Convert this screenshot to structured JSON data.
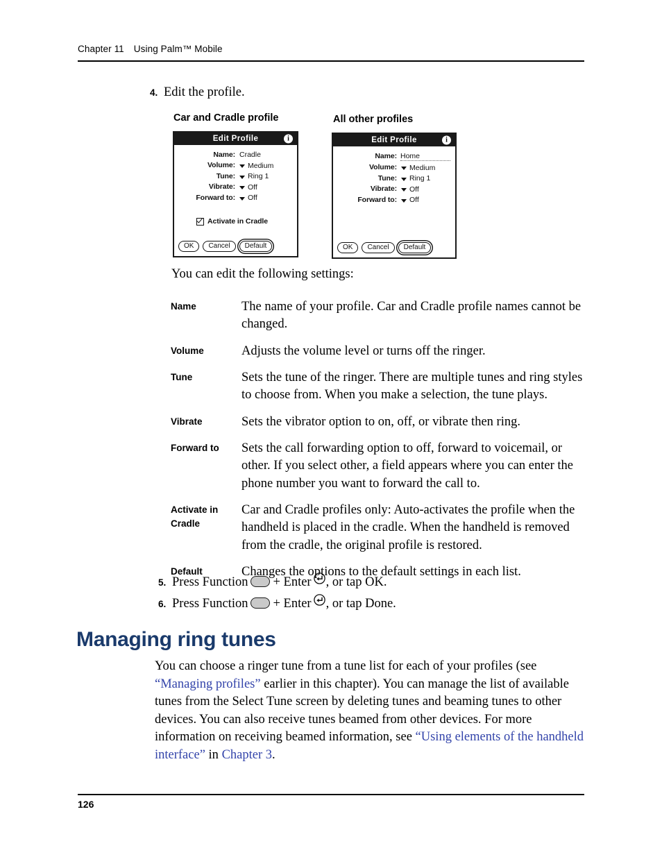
{
  "header": {
    "chapter": "Chapter 11",
    "title": "Using Palm™ Mobile"
  },
  "steps": {
    "step4": {
      "number": "4.",
      "text": "Edit the profile."
    },
    "step5": {
      "number": "5.",
      "prefix": "Press Function",
      "middle": "+ Enter",
      "suffix": ", or tap OK."
    },
    "step6": {
      "number": "6.",
      "prefix": "Press Function",
      "middle": "+ Enter",
      "suffix": ", or tap Done."
    }
  },
  "figure": {
    "left_label": "Car and Cradle profile",
    "right_label": "All other profiles",
    "left_device": {
      "title": "Edit Profile",
      "info_icon": "info-icon",
      "fields": [
        {
          "label": "Name:",
          "value": "Cradle",
          "has_dropdown": false,
          "editable": false
        },
        {
          "label": "Volume:",
          "value": "Medium",
          "has_dropdown": true,
          "editable": false
        },
        {
          "label": "Tune:",
          "value": "Ring 1",
          "has_dropdown": true,
          "editable": false
        },
        {
          "label": "Vibrate:",
          "value": "Off",
          "has_dropdown": true,
          "editable": false
        },
        {
          "label": "Forward to:",
          "value": "Off",
          "has_dropdown": true,
          "editable": false
        }
      ],
      "checkbox_label": "Activate in Cradle",
      "checkbox_checked": true,
      "buttons": [
        {
          "label": "OK",
          "emphasis": false
        },
        {
          "label": "Cancel",
          "emphasis": false
        },
        {
          "label": "Default",
          "emphasis": true
        }
      ]
    },
    "right_device": {
      "title": "Edit Profile",
      "info_icon": "info-icon",
      "fields": [
        {
          "label": "Name:",
          "value": "Home",
          "has_dropdown": false,
          "editable": true
        },
        {
          "label": "Volume:",
          "value": "Medium",
          "has_dropdown": true,
          "editable": false
        },
        {
          "label": "Tune:",
          "value": "Ring 1",
          "has_dropdown": true,
          "editable": false
        },
        {
          "label": "Vibrate:",
          "value": "Off",
          "has_dropdown": true,
          "editable": false
        },
        {
          "label": "Forward to:",
          "value": "Off",
          "has_dropdown": true,
          "editable": false
        }
      ],
      "buttons": [
        {
          "label": "OK",
          "emphasis": false
        },
        {
          "label": "Cancel",
          "emphasis": false
        },
        {
          "label": "Default",
          "emphasis": true
        }
      ]
    }
  },
  "intro_paragraph": "You can edit the following settings:",
  "settings": [
    {
      "term": "Name",
      "description": "The name of your profile. Car and Cradle profile names cannot be changed."
    },
    {
      "term": "Volume",
      "description": "Adjusts the volume level or turns off the ringer."
    },
    {
      "term": "Tune",
      "description": "Sets the tune of the ringer. There are multiple tunes and ring styles to choose from. When you make a selection, the tune plays."
    },
    {
      "term": "Vibrate",
      "description": "Sets the vibrator option to on, off, or vibrate then ring."
    },
    {
      "term": "Forward to",
      "description": "Sets the call forwarding option to off, forward to voicemail, or other. If you select other, a field appears where you can enter the phone number you want to forward the call to."
    },
    {
      "term": "Activate in Cradle",
      "description": "Car and Cradle profiles only: Auto-activates the profile when the handheld is placed in the cradle. When the handheld is removed from the cradle, the original profile is restored."
    },
    {
      "term": "Default",
      "description": "Changes the options to the default settings in each list."
    }
  ],
  "section": {
    "heading": "Managing ring tunes",
    "paragraph": {
      "part1": "You can choose a ringer tune from a tune list for each of your profiles (see ",
      "link1": "“Managing profiles”",
      "part2": " earlier in this chapter). You can manage the list of available tunes from the Select Tune screen by deleting tunes and beaming tunes to other devices. You can also receive tunes beamed from other devices. For more information on receiving beamed information, see ",
      "link2": "“Using elements of the handheld interface”",
      "part3": " in ",
      "link3": "Chapter 3",
      "part4": "."
    }
  },
  "footer": {
    "page_number": "126"
  },
  "colors": {
    "heading": "#1a3a6b",
    "link": "#3344aa",
    "rule": "#000000"
  }
}
